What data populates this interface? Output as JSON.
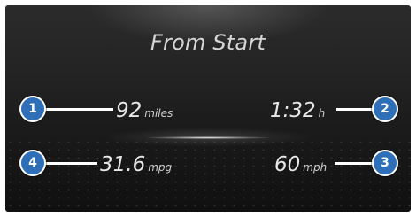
{
  "title": "From Start",
  "readings": {
    "distance": {
      "callout": "1",
      "value": "92",
      "unit": "miles"
    },
    "time": {
      "callout": "2",
      "value": "1:32",
      "unit": "h"
    },
    "speed": {
      "callout": "3",
      "value": "60",
      "unit": "mph"
    },
    "consumption": {
      "callout": "4",
      "value": "31.6",
      "unit": "mpg"
    }
  },
  "colors": {
    "callout_fill": "#2f6fb7",
    "callout_border": "#ffffff",
    "text": "#e8e8e8"
  }
}
